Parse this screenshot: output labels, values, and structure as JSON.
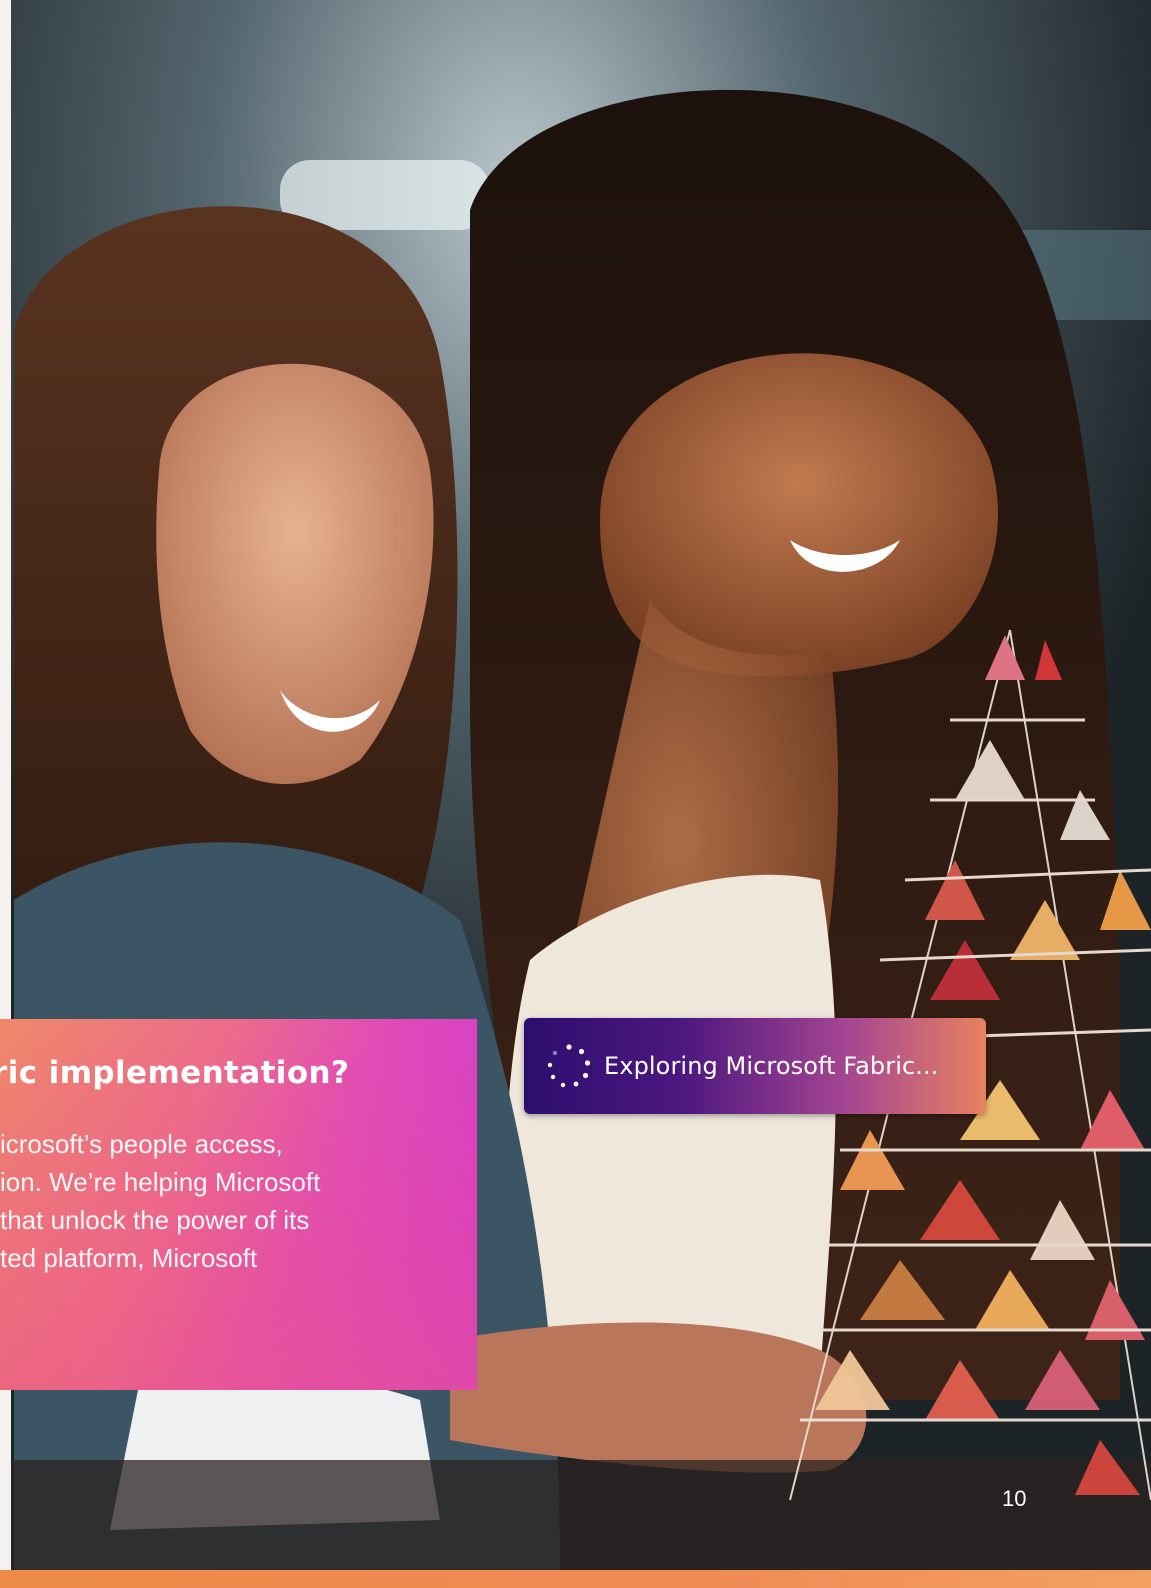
{
  "hero_photo": {
    "description_icon": "photo-two-smiling-women-building-paper-model"
  },
  "callout": {
    "title": "ric implementation?",
    "body_lines": [
      "icrosoft’s people access,",
      "ion. We’re helping Microsoft",
      "that unlock the power of its",
      "ted platform, Microsoft"
    ]
  },
  "badge": {
    "icon": "loading-dots-icon",
    "label": "Exploring Microsoft Fabric..."
  },
  "footer": {
    "page_number": "10"
  },
  "colors": {
    "callout_start": "#f08868",
    "callout_end": "#cf33d6",
    "badge_start": "#2c0d6e",
    "badge_end": "#e8825e",
    "footer_bar": "#ec8a47"
  }
}
